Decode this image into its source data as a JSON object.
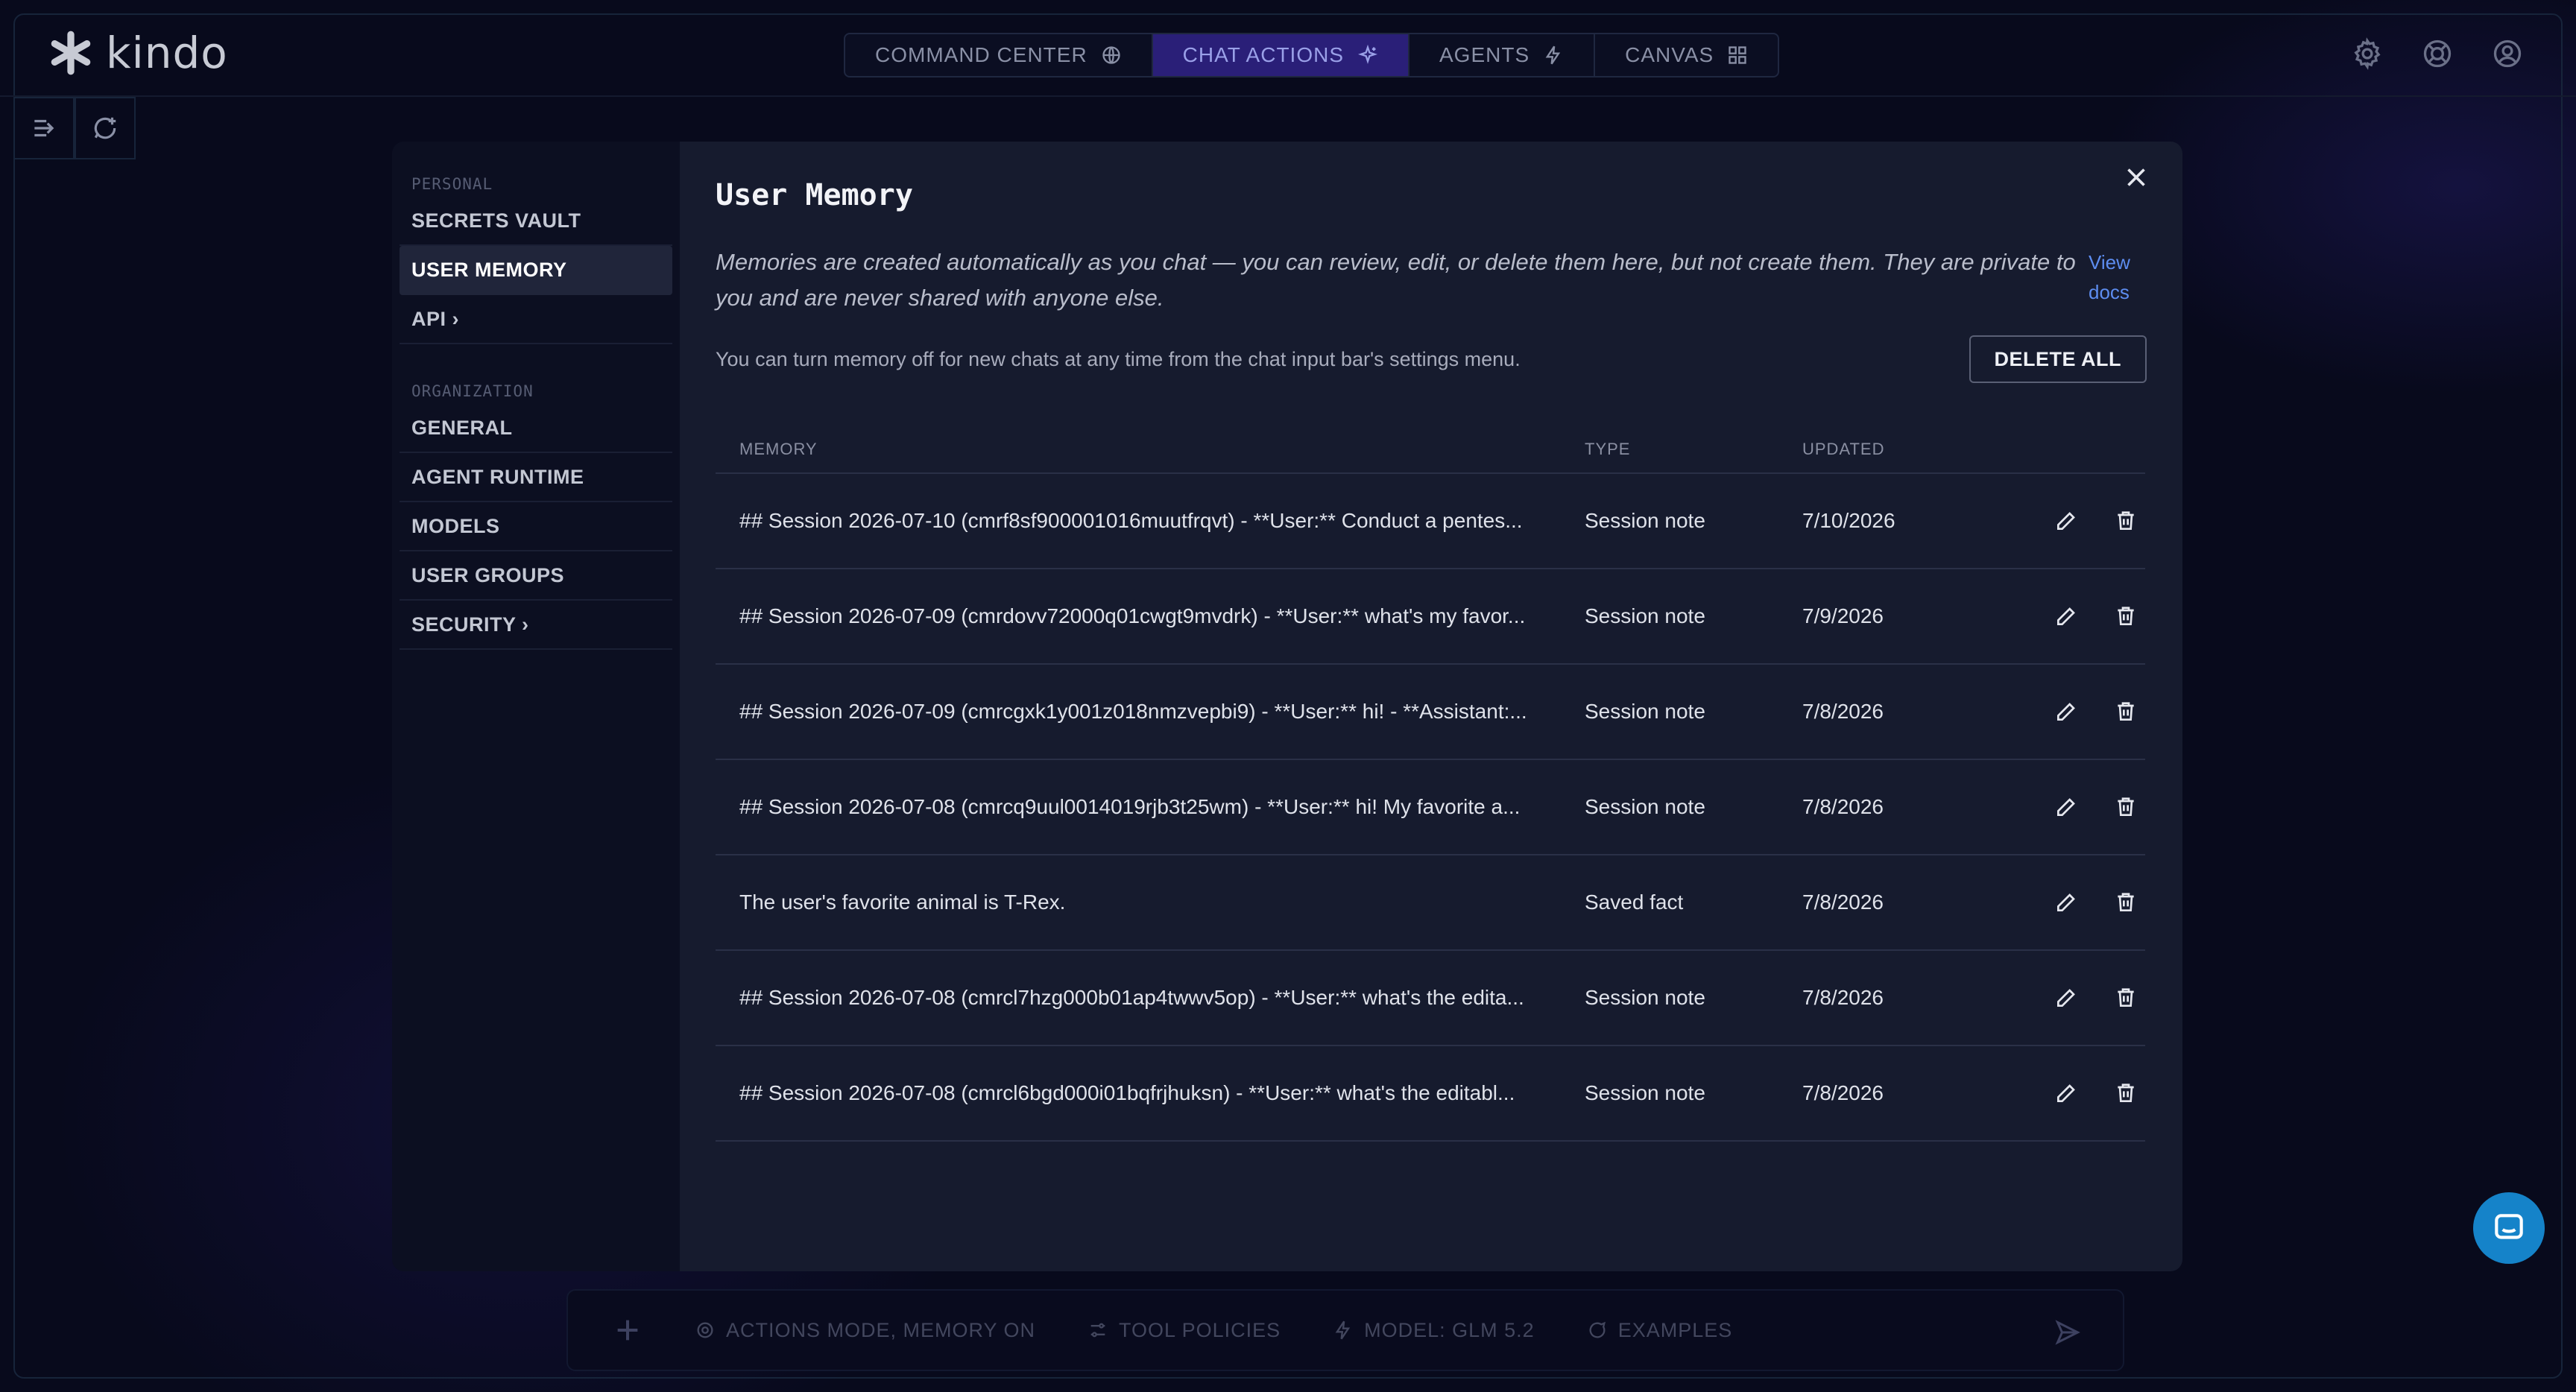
{
  "brand": {
    "name": "kindo"
  },
  "modes": [
    {
      "label": "COMMAND CENTER",
      "icon": "globe-icon"
    },
    {
      "label": "CHAT ACTIONS",
      "icon": "sparkle-icon",
      "active": true
    },
    {
      "label": "AGENTS",
      "icon": "bolt-icon"
    },
    {
      "label": "CANVAS",
      "icon": "grid-icon"
    }
  ],
  "top_icons": [
    "gear-icon",
    "lifebuoy-icon",
    "user-circle-icon"
  ],
  "sidebar": {
    "personal_label": "PERSONAL",
    "personal_items": [
      "SECRETS VAULT",
      "USER MEMORY",
      "API ›"
    ],
    "organization_label": "ORGANIZATION",
    "organization_items": [
      "GENERAL",
      "AGENT RUNTIME",
      "MODELS",
      "USER GROUPS",
      "SECURITY ›"
    ]
  },
  "modal": {
    "title": "User Memory",
    "description": "Memories are created automatically as you chat — you can review, edit, or delete them here, but not create them. They are private to you and are never shared with anyone else.",
    "view_docs": "View docs",
    "info": "You can turn memory off for new chats at any time from the chat input bar's settings menu.",
    "delete_all": "DELETE ALL",
    "columns": {
      "memory": "MEMORY",
      "type": "TYPE",
      "updated": "UPDATED"
    },
    "rows": [
      {
        "memory": "## Session 2026-07-10 (cmrf8sf900001016muutfrqvt) - **User:** Conduct a pentes...",
        "type": "Session note",
        "updated": "7/10/2026"
      },
      {
        "memory": "## Session 2026-07-09 (cmrdovv72000q01cwgt9mvdrk) - **User:** what's my favor...",
        "type": "Session note",
        "updated": "7/9/2026"
      },
      {
        "memory": "## Session 2026-07-09 (cmrcgxk1y001z018nmzvepbi9) - **User:** hi! - **Assistant:...",
        "type": "Session note",
        "updated": "7/8/2026"
      },
      {
        "memory": "## Session 2026-07-08 (cmrcq9uul0014019rjb3t25wm) - **User:** hi! My favorite a...",
        "type": "Session note",
        "updated": "7/8/2026"
      },
      {
        "memory": "The user's favorite animal is T-Rex.",
        "type": "Saved fact",
        "updated": "7/8/2026"
      },
      {
        "memory": "## Session 2026-07-08 (cmrcl7hzg000b01ap4twwv5op) - **User:** what's the edita...",
        "type": "Session note",
        "updated": "7/8/2026"
      },
      {
        "memory": "## Session 2026-07-08 (cmrcl6bgd000i01bqfrjhuksn) - **User:** what's the editabl...",
        "type": "Session note",
        "updated": "7/8/2026"
      }
    ]
  },
  "chatbar": {
    "items": [
      {
        "label": "ACTIONS MODE, MEMORY ON",
        "icon": "gear-icon"
      },
      {
        "label": "TOOL POLICIES",
        "icon": "sliders-icon"
      },
      {
        "label": "MODEL: GLM 5.2",
        "icon": "bolt-icon"
      },
      {
        "label": "EXAMPLES",
        "icon": "chat-bubble-icon"
      }
    ]
  }
}
